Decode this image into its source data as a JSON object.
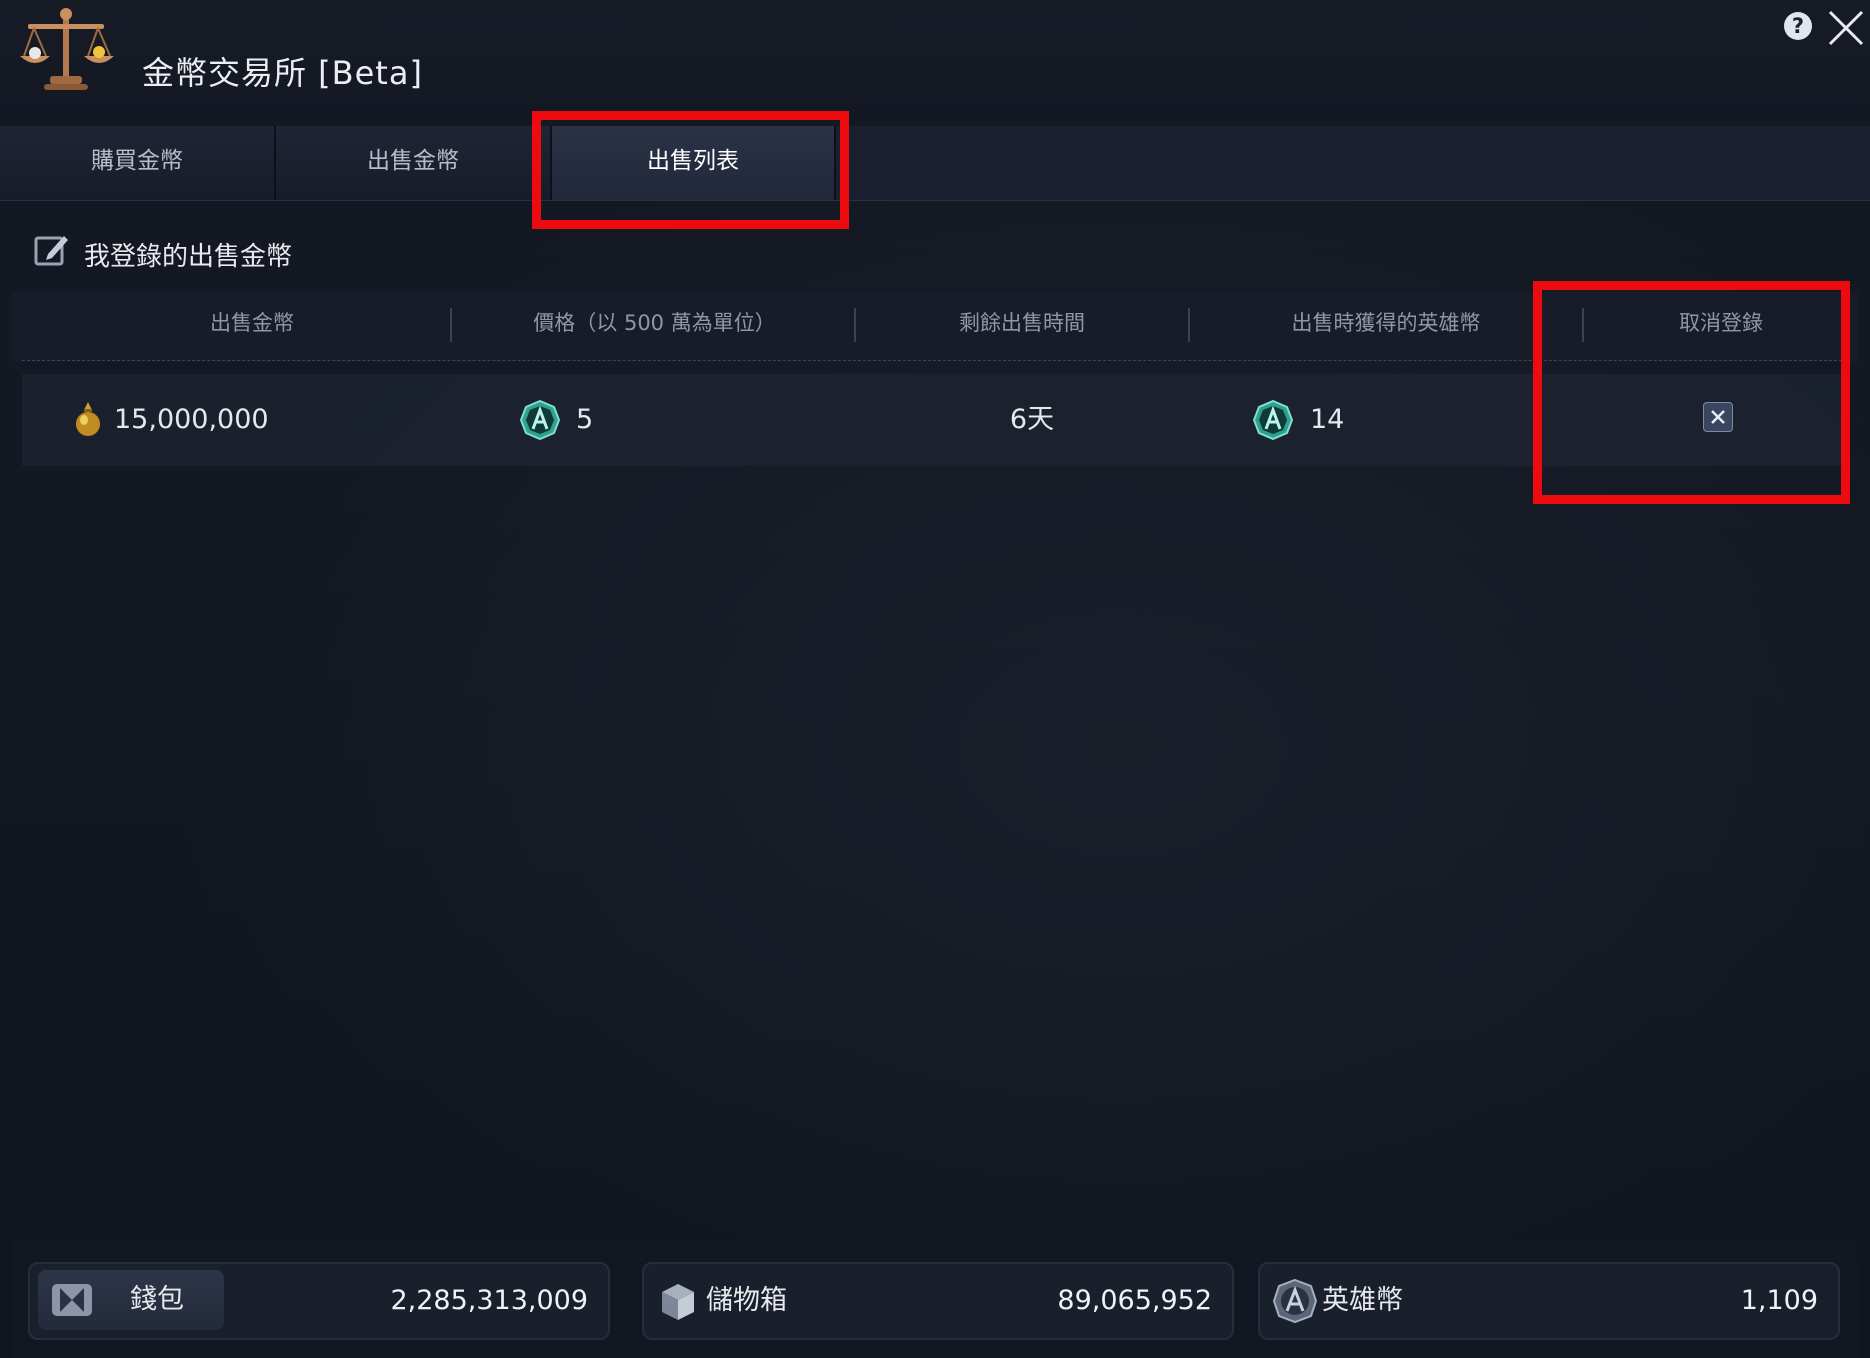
{
  "window": {
    "title": "金幣交易所 [Beta]",
    "help_label": "?"
  },
  "tabs": [
    {
      "label": "購買金幣",
      "active": false
    },
    {
      "label": "出售金幣",
      "active": false
    },
    {
      "label": "出售列表",
      "active": true
    }
  ],
  "section": {
    "title": "我登錄的出售金幣"
  },
  "table": {
    "columns": [
      "出售金幣",
      "價格（以 500 萬為單位）",
      "剩餘出售時間",
      "出售時獲得的英雄幣",
      "取消登錄"
    ],
    "rows": [
      {
        "gold_amount": "15,000,000",
        "price": "5",
        "remaining_time": "6天",
        "hero_coins": "14"
      }
    ]
  },
  "footer": {
    "wallet": {
      "label": "錢包",
      "value": "2,285,313,009"
    },
    "storage": {
      "label": "儲物箱",
      "value": "89,065,952"
    },
    "hero_coins": {
      "label": "英雄幣",
      "value": "1,109"
    }
  },
  "colors": {
    "highlight": "#ee0b10",
    "background": "#11151f",
    "tab_active": "#2b3246",
    "hero_coin": "#3fbfae",
    "gold": "#d9a52a"
  },
  "icons": [
    "scales-icon",
    "help-icon",
    "close-icon",
    "edit-icon",
    "gold-pouch-icon",
    "hero-coin-icon",
    "cancel-x-icon",
    "wallet-icon",
    "storage-chest-icon"
  ]
}
